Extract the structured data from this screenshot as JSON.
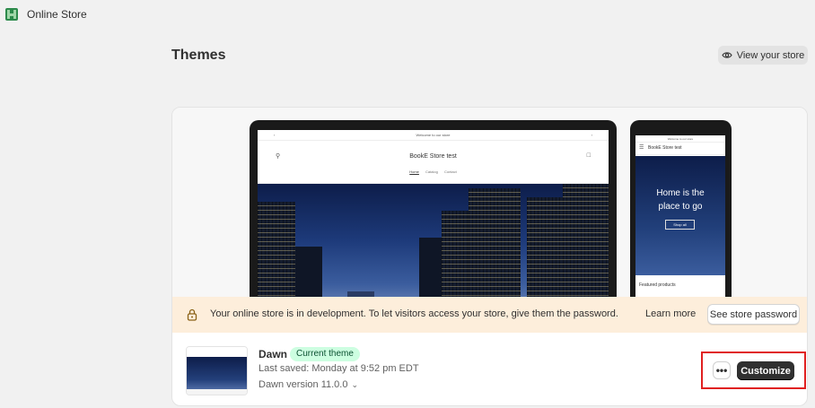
{
  "app": {
    "title": "Online Store",
    "brand_color": "#008060"
  },
  "page": {
    "title": "Themes",
    "view_store_label": "View your store"
  },
  "preview": {
    "desktop": {
      "announcement": "Welcome to our store",
      "store_name": "BookE Store test",
      "nav": [
        "Home",
        "Catalog",
        "Contact"
      ]
    },
    "mobile": {
      "announcement": "Welcome to our store",
      "store_name": "BookE Store test",
      "hero_line1": "Home is the",
      "hero_line2": "place to go",
      "hero_button": "Shop all",
      "featured": "Featured products"
    }
  },
  "banner": {
    "text": "Your online store is in development. To let visitors access your store, give them the password.",
    "learn_more": "Learn more",
    "password_button": "See store password",
    "background": "#fdeedb"
  },
  "theme": {
    "name": "Dawn",
    "badge": "Current theme",
    "last_saved": "Last saved: Monday at 9:52 pm EDT",
    "version": "Dawn version 11.0.0",
    "more_label": "•••",
    "customize_label": "Customize",
    "highlight_color": "#e02020"
  }
}
